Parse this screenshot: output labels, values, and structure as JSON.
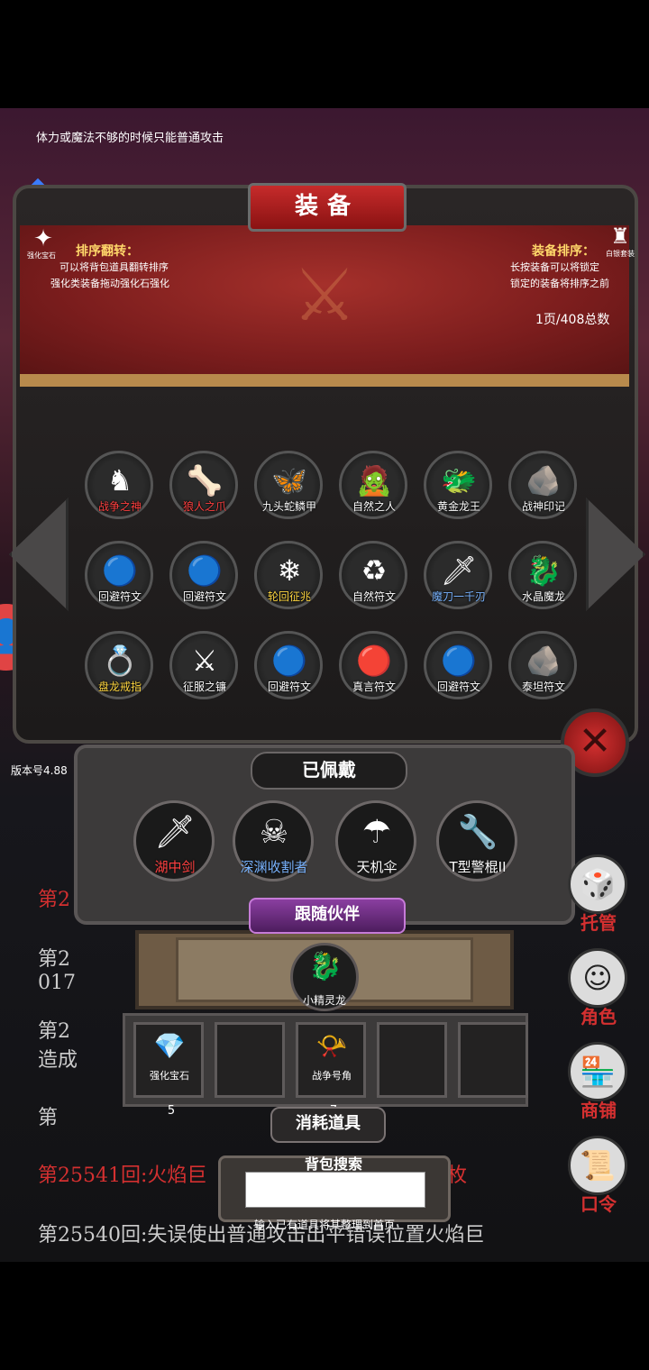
{
  "hint": "体力或魔法不够的时候只能普通攻击",
  "version": "版本号4.88",
  "log": [
    "第25541回:火焰巨",
    "枚",
    "第25540回:失误使出普通攻击出平错误位置火焰巨",
    "第2",
    "017",
    "第2",
    "造成",
    "第"
  ],
  "panel": {
    "title": "装备",
    "left_icon_label": "强化宝石",
    "right_icon_label": "白银套装",
    "note_left_title": "排序翻转：",
    "note_left_1": "可以将背包道具翻转排序",
    "note_left_2": "强化类装备拖动强化石强化",
    "note_right_title": "装备排序：",
    "note_right_1": "长按装备可以将锁定",
    "note_right_2": "锁定的装备将排序之前",
    "pages": "1页/408总数"
  },
  "items": [
    {
      "label": "战争之神",
      "color": "#ff4040",
      "icon": "knight-icon"
    },
    {
      "label": "狼人之爪",
      "color": "#ff4040",
      "icon": "claw-icon"
    },
    {
      "label": "九头蛇鳞甲",
      "color": "#ffffff",
      "icon": "scale-armor-icon"
    },
    {
      "label": "自然之人",
      "color": "#ffffff",
      "icon": "nature-man-icon"
    },
    {
      "label": "黄金龙王",
      "color": "#ffffff",
      "icon": "gold-dragon-icon"
    },
    {
      "label": "战神印记",
      "color": "#ffffff",
      "icon": "ore-icon"
    },
    {
      "label": "回避符文",
      "color": "#ffffff",
      "icon": "blue-orb-icon"
    },
    {
      "label": "回避符文",
      "color": "#ffffff",
      "icon": "blue-orb-icon"
    },
    {
      "label": "轮回征兆",
      "color": "#ffd740",
      "icon": "ice-staff-icon"
    },
    {
      "label": "自然符文",
      "color": "#ffffff",
      "icon": "green-rune-icon"
    },
    {
      "label": "魔刀一千刃",
      "color": "#7ab4ff",
      "icon": "katana-icon"
    },
    {
      "label": "水晶魔龙",
      "color": "#ffffff",
      "icon": "crystal-dragon-icon"
    },
    {
      "label": "盘龙戒指",
      "color": "#ffd740",
      "icon": "ring-icon"
    },
    {
      "label": "征服之镰",
      "color": "#ffffff",
      "icon": "scythe-icon"
    },
    {
      "label": "回避符文",
      "color": "#ffffff",
      "icon": "blue-orb-icon"
    },
    {
      "label": "真言符文",
      "color": "#ffffff",
      "icon": "red-rune-icon"
    },
    {
      "label": "回避符文",
      "color": "#ffffff",
      "icon": "blue-orb-icon"
    },
    {
      "label": "泰坦符文",
      "color": "#ffffff",
      "icon": "lava-ore-icon"
    }
  ],
  "worn": {
    "title": "已佩戴",
    "items": [
      {
        "label": "湖中剑",
        "color": "#ff4040",
        "icon": "sword-icon"
      },
      {
        "label": "深渊收割者",
        "color": "#7ab4ff",
        "icon": "reaper-icon"
      },
      {
        "label": "天机伞",
        "color": "#ffffff",
        "icon": "umbrella-icon"
      },
      {
        "label": "T型警棍II",
        "color": "#ffffff",
        "icon": "baton-icon"
      }
    ]
  },
  "companion": {
    "title": "跟随伙伴",
    "label": "小精灵龙",
    "icon": "sprite-dragon-icon"
  },
  "consumables": {
    "title": "消耗道具",
    "items": [
      {
        "label": "强化宝石",
        "count": "5",
        "icon": "gem-icon"
      },
      {
        "label": "",
        "count": "",
        "icon": ""
      },
      {
        "label": "战争号角",
        "count": "7",
        "icon": "horn-icon"
      },
      {
        "label": "",
        "count": "",
        "icon": ""
      },
      {
        "label": "",
        "count": "",
        "icon": ""
      }
    ]
  },
  "search": {
    "label": "背包搜索",
    "placeholder": "",
    "hint": "输入已有道具将其整理到首页"
  },
  "side_menu": [
    {
      "label": "托管",
      "icon": "dice-icon"
    },
    {
      "label": "角色",
      "icon": "character-icon"
    },
    {
      "label": "商铺",
      "icon": "shop-icon"
    },
    {
      "label": "口令",
      "icon": "scroll-icon"
    }
  ],
  "colors": {
    "accent": "#d43030",
    "gold": "#ffd76a"
  }
}
